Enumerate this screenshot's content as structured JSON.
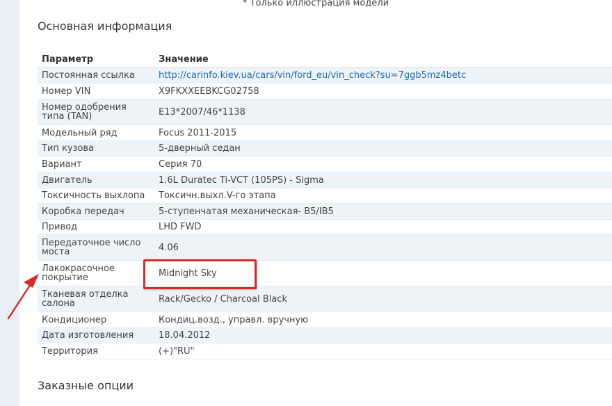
{
  "note": "* Только иллюстрация модели",
  "sections": {
    "main_title": "Основная информация",
    "options_title": "Заказные опции"
  },
  "table": {
    "headers": {
      "param": "Параметр",
      "value": "Значение"
    },
    "rows": [
      {
        "param": "Постоянная ссылка",
        "value": "http://carinfo.kiev.ua/cars/vin/ford_eu/vin_check?su=7ggb5mz4betc",
        "link": true
      },
      {
        "param": "Номер VIN",
        "value": "X9FKXXEEBKCG02758"
      },
      {
        "param": "Номер одобрения типа (TAN)",
        "value": "E13*2007/46*1138"
      },
      {
        "param": "Модельный ряд",
        "value": "Focus 2011-2015"
      },
      {
        "param": "Тип кузова",
        "value": "5-дверный седан"
      },
      {
        "param": "Вариант",
        "value": "Серия 70"
      },
      {
        "param": "Двигатель",
        "value": "1.6L Duratec Ti-VCT (105PS) - Sigma"
      },
      {
        "param": "Токсичность выхлопа",
        "value": "Токсичн.выхл.V-го этапа"
      },
      {
        "param": "Коробка передач",
        "value": "5-ступенчатая механическая- B5/IB5"
      },
      {
        "param": "Привод",
        "value": "LHD FWD"
      },
      {
        "param": "Передаточное число моста",
        "value": "4.06"
      },
      {
        "param": "Лакокрасочное покрытие",
        "value": "Midnight Sky"
      },
      {
        "param": "Тканевая отделка салона",
        "value": "Rack/Gecko / Charcoal Black"
      },
      {
        "param": "Кондиционер",
        "value": "Кондиц.возд., управл. вручную"
      },
      {
        "param": "Дата изготовления",
        "value": "18.04.2012"
      },
      {
        "param": "Территория",
        "value": "(+)\"RU\""
      }
    ]
  },
  "colors": {
    "annotation": "#d42a2a",
    "link": "#1e6aa8",
    "row_alt": "#eef3f8"
  }
}
